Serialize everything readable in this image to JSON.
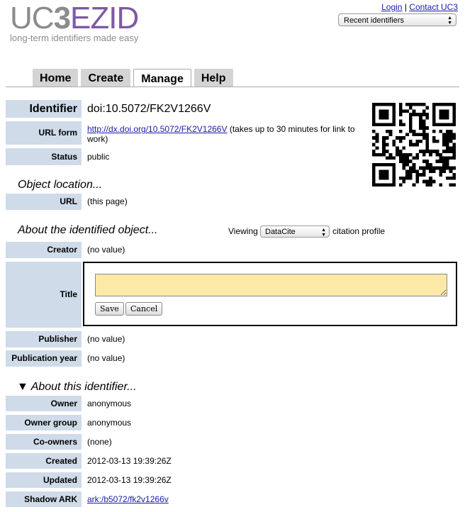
{
  "header": {
    "logo_uc": "UC",
    "logo_3": "3",
    "logo_ezid": "EZID",
    "tagline": "long-term identifiers made easy",
    "login": "Login",
    "sep": "|",
    "contact": "Contact UC3",
    "recent": "Recent identifiers"
  },
  "tabs": [
    "Home",
    "Create",
    "Manage",
    "Help"
  ],
  "identifier": {
    "label": "Identifier",
    "value": "doi:10.5072/FK2V1266V",
    "url_label": "URL form",
    "url_link": "http://dx.doi.org/10.5072/FK2V1266V",
    "url_note": "(takes up to 30 minutes for link to work)",
    "status_label": "Status",
    "status_value": "public"
  },
  "location": {
    "heading": "Object location...",
    "url_label": "URL",
    "url_value": "(this page)"
  },
  "about_object": {
    "heading": "About the identified object...",
    "viewing": "Viewing",
    "profile": "DataCite",
    "profile_suffix": "citation profile",
    "creator_label": "Creator",
    "creator_value": "(no value)",
    "title_label": "Title",
    "title_value": "",
    "save": "Save",
    "cancel": "Cancel",
    "publisher_label": "Publisher",
    "publisher_value": "(no value)",
    "pubyear_label": "Publication year",
    "pubyear_value": "(no value)"
  },
  "about_identifier": {
    "heading": "▼ About this identifier...",
    "owner_label": "Owner",
    "owner_value": "anonymous",
    "group_label": "Owner group",
    "group_value": "anonymous",
    "coowners_label": "Co-owners",
    "coowners_value": "(none)",
    "created_label": "Created",
    "created_value": "2012-03-13 19:39:26Z",
    "updated_label": "Updated",
    "updated_value": "2012-03-13 19:39:26Z",
    "ark_label": "Shadow ARK",
    "ark_value": "ark:/b5072/fk2v1266v"
  }
}
